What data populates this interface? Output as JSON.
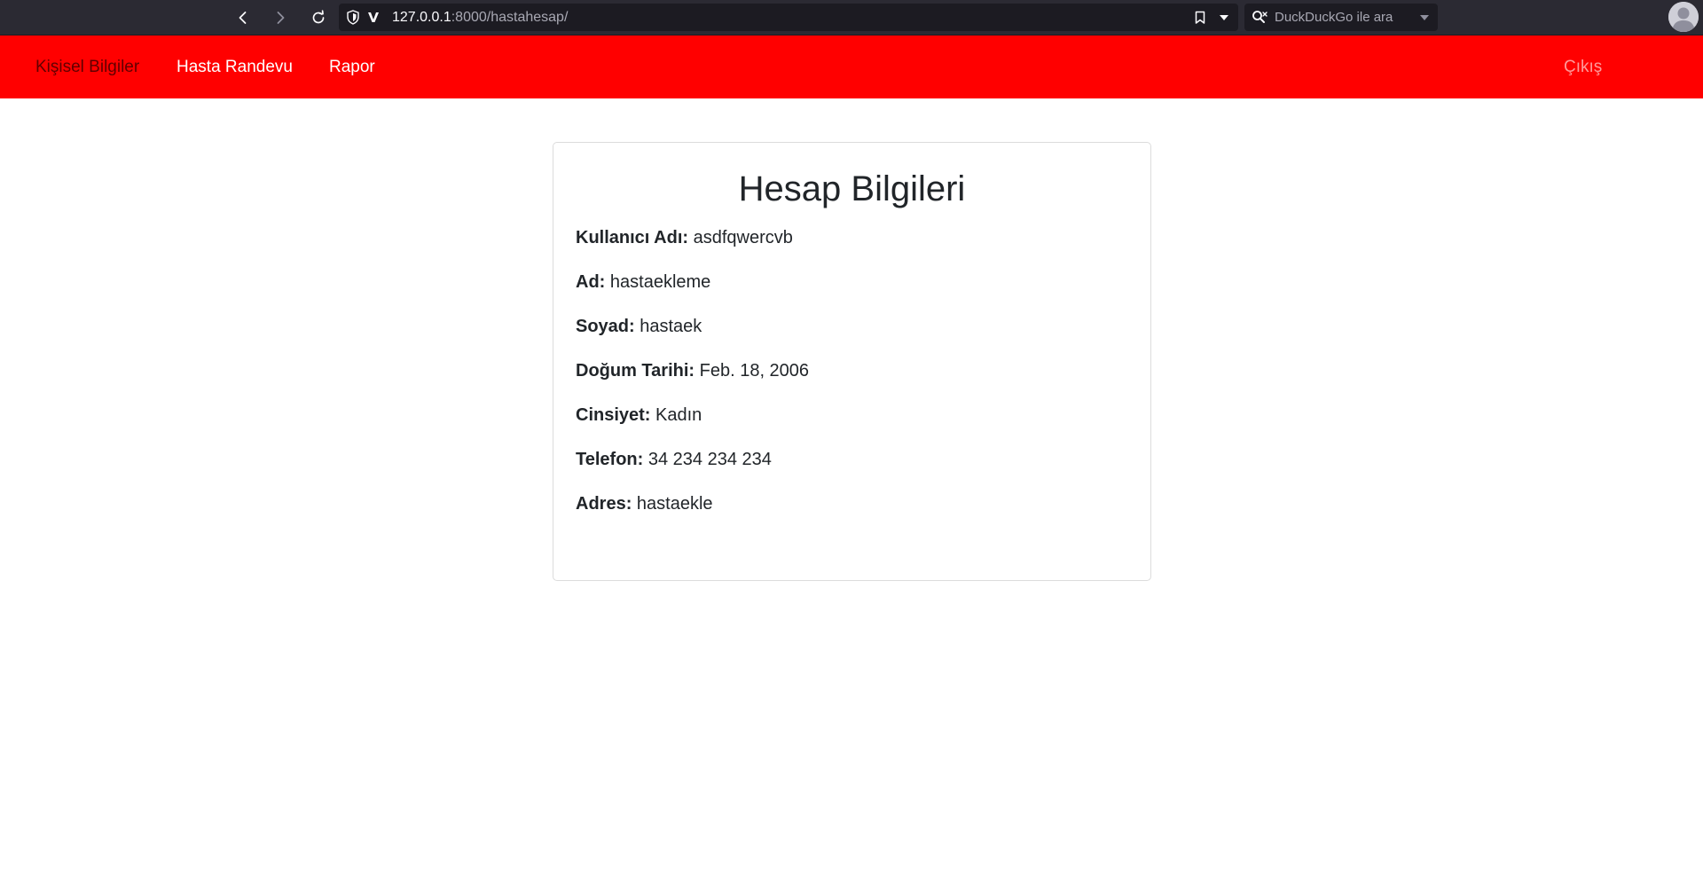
{
  "browser": {
    "url_host": "127.0.0.1",
    "url_path": ":8000/hastahesap/",
    "search_placeholder": "DuckDuckGo ile ara"
  },
  "navbar": {
    "background": "#ff0000",
    "links": [
      {
        "label": "Kişisel Bilgiler",
        "state": "active"
      },
      {
        "label": "Hasta Randevu",
        "state": "normal"
      },
      {
        "label": "Rapor",
        "state": "normal"
      }
    ],
    "logout_label": "Çıkış"
  },
  "account": {
    "title": "Hesap Bilgileri",
    "fields": [
      {
        "label": "Kullanıcı Adı:",
        "value": "asdfqwercvb"
      },
      {
        "label": "Ad:",
        "value": "hastaekleme"
      },
      {
        "label": "Soyad:",
        "value": "hastaek"
      },
      {
        "label": "Doğum Tarihi:",
        "value": "Feb. 18, 2006"
      },
      {
        "label": "Cinsiyet:",
        "value": "Kadın"
      },
      {
        "label": "Telefon:",
        "value": "34 234 234 234"
      },
      {
        "label": "Adres:",
        "value": "hastaekle"
      }
    ]
  }
}
